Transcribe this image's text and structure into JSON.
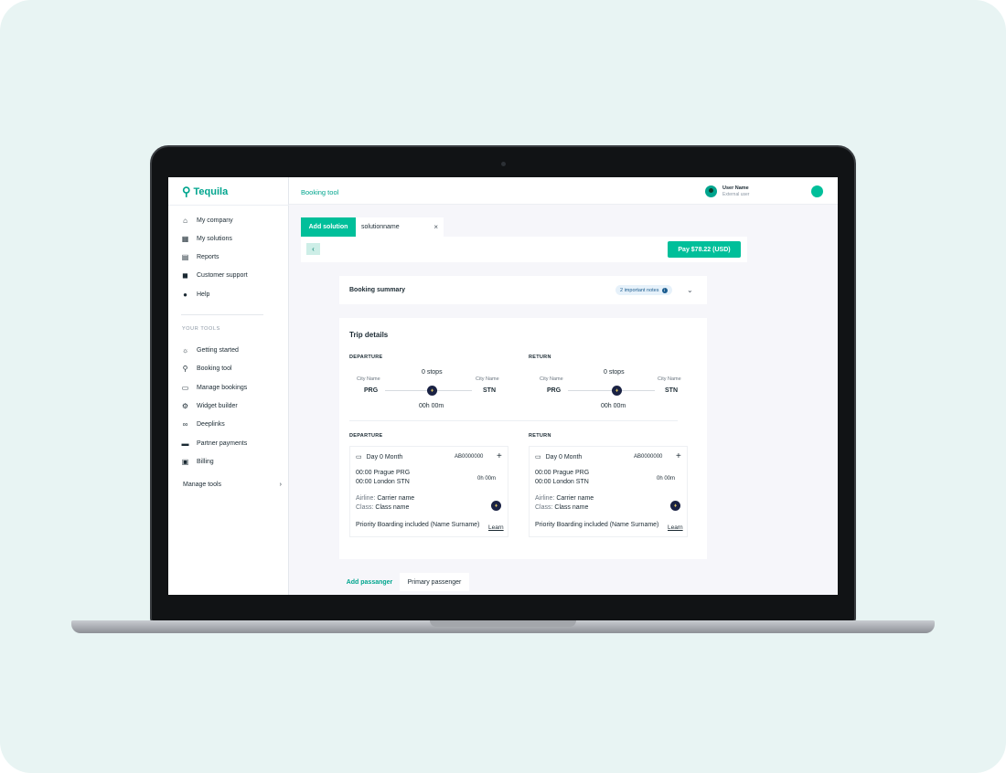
{
  "app": {
    "name": "Tequila",
    "section_title": "Booking tool"
  },
  "user": {
    "name": "User Name",
    "role": "External user"
  },
  "sidebar": {
    "items": [
      {
        "label": "My company",
        "icon": "home-icon"
      },
      {
        "label": "My solutions",
        "icon": "grid-icon"
      },
      {
        "label": "Reports",
        "icon": "chart-icon"
      },
      {
        "label": "Customer support",
        "icon": "chat-icon"
      },
      {
        "label": "Help",
        "icon": "help-icon"
      }
    ],
    "tools_heading": "YOUR TOOLS",
    "tools": [
      {
        "label": "Getting started",
        "icon": "lightbulb-icon"
      },
      {
        "label": "Booking tool",
        "icon": "search-icon"
      },
      {
        "label": "Manage bookings",
        "icon": "calendar-icon"
      },
      {
        "label": "Widget builder",
        "icon": "gear-icon"
      },
      {
        "label": "Deeplinks",
        "icon": "link-icon"
      },
      {
        "label": "Partner payments",
        "icon": "card-icon"
      },
      {
        "label": "Billing",
        "icon": "billing-icon"
      }
    ],
    "manage_tools": "Manage tools",
    "manage_chevron": "›"
  },
  "tabs": {
    "add_label": "Add solution",
    "name": "solutionname",
    "close": "×"
  },
  "toolbar": {
    "back": "‹",
    "pay_label": "Pay $78.22 (USD)"
  },
  "summary": {
    "title": "Booking summary",
    "notes": "2 important notes",
    "info": "i",
    "chevron": "⌄"
  },
  "trip": {
    "title": "Trip details",
    "legs": [
      {
        "heading": "DEPARTURE",
        "from_label": "City Name",
        "from_code": "PRG",
        "to_label": "City Name",
        "to_code": "STN",
        "stops": "0 stops",
        "duration": "00h 00m"
      },
      {
        "heading": "RETURN",
        "from_label": "City Name",
        "from_code": "PRG",
        "to_label": "City Name",
        "to_code": "STN",
        "stops": "0 stops",
        "duration": "00h 00m"
      }
    ],
    "segments": [
      {
        "heading": "DEPARTURE",
        "date": "Day 0 Month",
        "flight_no": "AB0000000",
        "plus": "+",
        "dep": "00:00 Prague PRG",
        "arr": "00:00 London STN",
        "duration": "0h 00m",
        "airline_label": "Airline:",
        "airline": "Carrier name",
        "class_label": "Class:",
        "class": "Class name",
        "priority": "Priority Boarding included (Name Surname)",
        "learn": "Learn"
      },
      {
        "heading": "RETURN",
        "date": "Day 0 Month",
        "flight_no": "AB0000000",
        "plus": "+",
        "dep": "00:00 Prague PRG",
        "arr": "00:00 London STN",
        "duration": "0h 00m",
        "airline_label": "Airline:",
        "airline": "Carrier name",
        "class_label": "Class:",
        "class": "Class name",
        "priority": "Priority Boarding included (Name Surname)",
        "learn": "Learn"
      }
    ]
  },
  "passengers": {
    "add_label": "Add passanger",
    "primary_label": "Primary passenger"
  },
  "colors": {
    "accent": "#00bf9a",
    "accent_text": "#00a58e",
    "background": "#e8f4f3",
    "airline_logo": "#1a2244"
  }
}
